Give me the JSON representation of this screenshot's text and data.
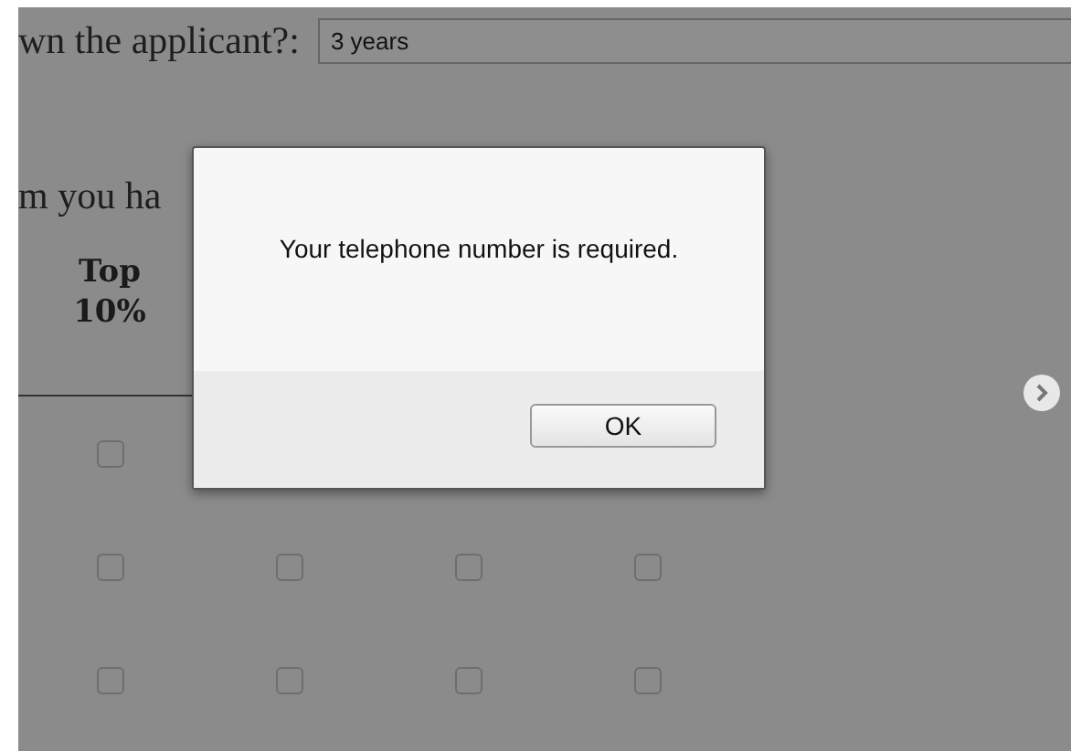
{
  "question": {
    "label": "wn the applicant?:",
    "value": "3 years"
  },
  "instruction": "m you ha",
  "columns": [
    "Top 10%"
  ],
  "rows": [
    {
      "cells": [
        {
          "checked": false
        }
      ]
    },
    {
      "cells": [
        {
          "checked": false
        },
        {
          "checked": false
        },
        {
          "checked": false
        },
        {
          "checked": false
        }
      ]
    },
    {
      "cells": [
        {
          "checked": false
        },
        {
          "checked": false
        },
        {
          "checked": false
        },
        {
          "checked": false
        }
      ]
    }
  ],
  "dialog": {
    "message": "Your telephone number is required.",
    "button": "OK"
  }
}
